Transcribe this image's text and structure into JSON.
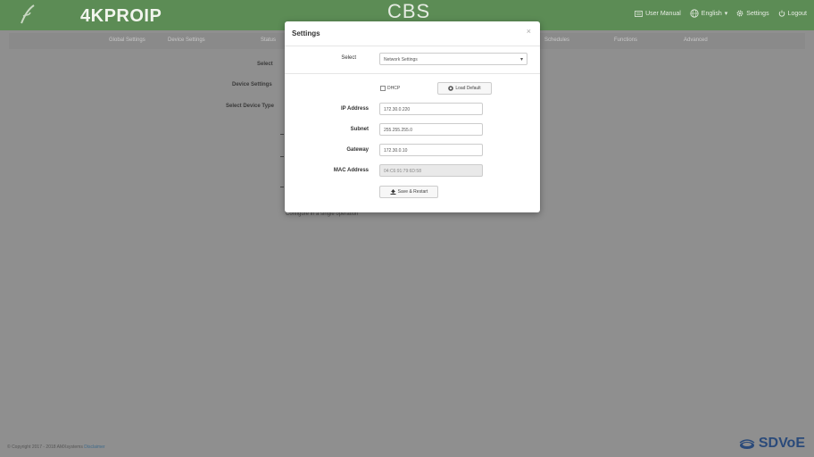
{
  "header": {
    "brand": "4KPROIP",
    "app_title": "CBS",
    "user_manual": "User Manual",
    "language": "English",
    "settings": "Settings",
    "logout": "Logout"
  },
  "nav": {
    "items": [
      "Global Settings",
      "Device Settings",
      "Status",
      "Schedules",
      "Functions",
      "Advanced"
    ]
  },
  "background": {
    "select_label": "Select",
    "device_settings_label": "Device Settings",
    "select_device_type_label": "Select Device Type",
    "note": "Configure in a single operation"
  },
  "modal": {
    "title": "Settings",
    "close": "×",
    "select_label": "Select",
    "select_value": "Network Settings",
    "dhcp_label": "DHCP",
    "dhcp_checked": false,
    "load_default": "Load Default",
    "ip_label": "IP Address",
    "ip_value": "172.30.0.220",
    "subnet_label": "Subnet",
    "subnet_value": "255.255.255.0",
    "gateway_label": "Gateway",
    "gateway_value": "172.30.0.10",
    "mac_label": "MAC Address",
    "mac_value": "04:C6:91:79:6D:58",
    "save_restart": "Save & Restart"
  },
  "footer": {
    "copyright": "© Copyright 2017 - 2018 AMXsystems",
    "link": "Disclaimer",
    "logo_text": "SDVoE"
  },
  "colors": {
    "header_bg": "#5c8c55",
    "overlay_bg": "#8f8f8f",
    "modal_bg": "#ffffff"
  }
}
